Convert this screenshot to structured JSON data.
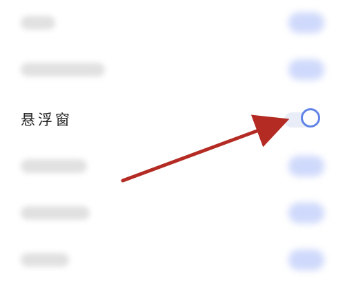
{
  "settings": {
    "floating_window_label": "悬浮窗"
  },
  "colors": {
    "accent": "#5f83e6",
    "arrow": "#b42b24",
    "label": "#222222",
    "toggle_track": "#e8edf8",
    "blurred_toggle": "#cfd9fb"
  },
  "icons": {
    "annotation_arrow": "arrow-right-icon"
  }
}
